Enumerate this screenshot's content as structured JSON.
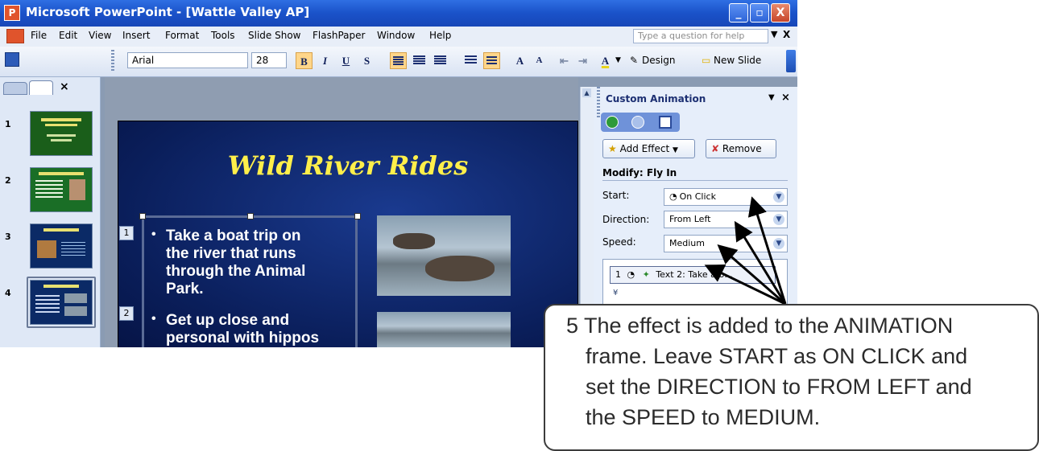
{
  "window": {
    "title": "Microsoft PowerPoint - [Wattle Valley AP]",
    "controls": [
      "_",
      "▫",
      "X"
    ]
  },
  "menubar": {
    "items": [
      "File",
      "Edit",
      "View",
      "Insert",
      "Format",
      "Tools",
      "Slide Show",
      "FlashPaper",
      "Window",
      "Help"
    ],
    "help_placeholder": "Type a question for help",
    "close": "X"
  },
  "toolbar": {
    "font_name": "Arial",
    "font_size": "28",
    "bold": "B",
    "italic": "I",
    "underline": "U",
    "shadow": "S",
    "design_label": "Design",
    "new_slide_label": "New Slide",
    "grow_font": "A",
    "shrink_font": "A",
    "font_color": "A"
  },
  "slides_panel": {
    "close": "×",
    "thumbnails": [
      {
        "num": "1"
      },
      {
        "num": "2"
      },
      {
        "num": "3"
      },
      {
        "num": "4"
      }
    ]
  },
  "slide": {
    "title": "Wild River Rides",
    "bullet_1": [
      "Take a boat trip on",
      "the river that runs",
      "through the Animal",
      "Park."
    ],
    "bullet_2": [
      "Get up close and",
      "personal with hippos"
    ],
    "anim_tags": [
      "1",
      "2"
    ]
  },
  "task_pane": {
    "title": "Custom Animation",
    "add_effect": "Add Effect",
    "remove": "Remove",
    "modify_heading": "Modify: Fly In",
    "start_label": "Start:",
    "start_value": "On Click",
    "direction_label": "Direction:",
    "direction_value": "From Left",
    "speed_label": "Speed:",
    "speed_value": "Medium",
    "list_item": "Text 2: Take a b...",
    "list_item_num": "1"
  },
  "callout": {
    "lines": [
      "5  The effect is added to the ANIMATION",
      "frame.  Leave START as ON CLICK and",
      "set the DIRECTION to FROM LEFT and",
      "the SPEED to MEDIUM."
    ]
  },
  "colors": {
    "titlebar": "#1a52c9",
    "slide_background": "#0a1e5a",
    "slide_title": "#ffef4a",
    "task_pane": "#e6eefa"
  }
}
